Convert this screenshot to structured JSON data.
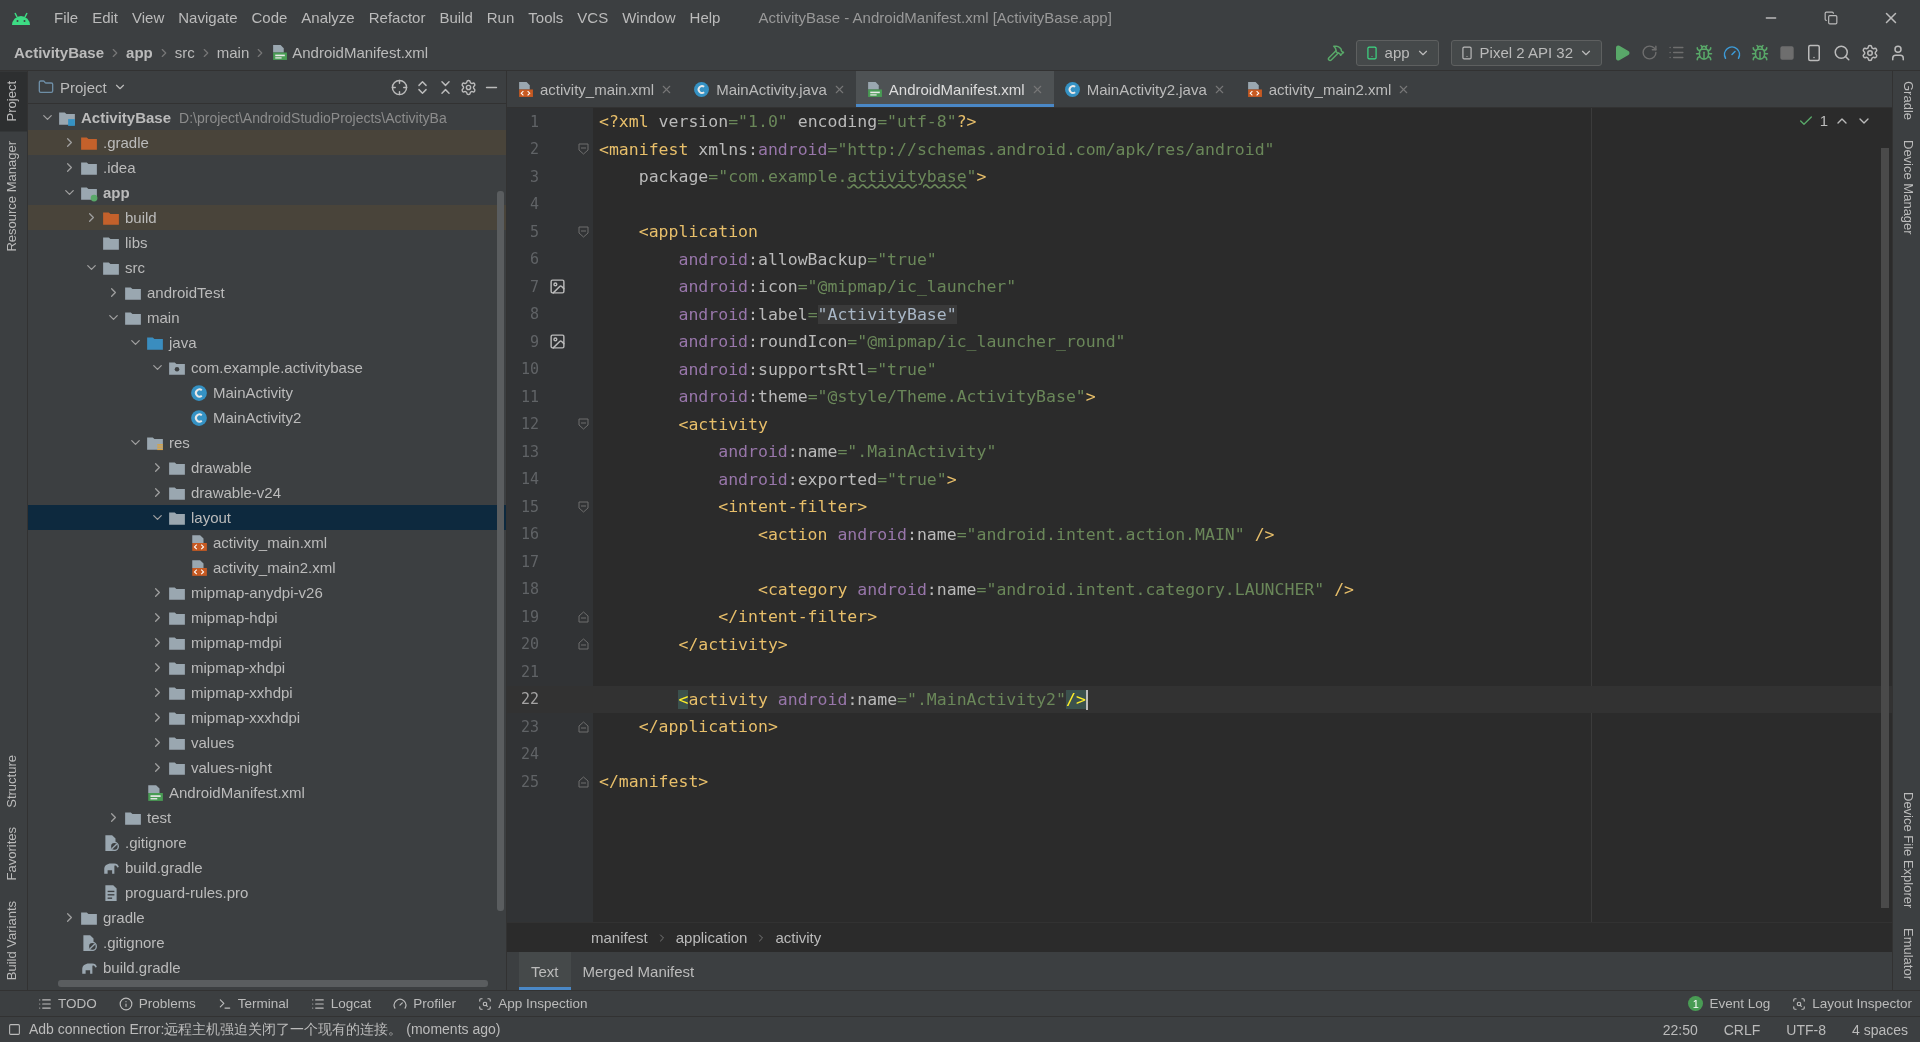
{
  "menu_bar": {
    "items": [
      "File",
      "Edit",
      "View",
      "Navigate",
      "Code",
      "Analyze",
      "Refactor",
      "Build",
      "Run",
      "Tools",
      "VCS",
      "Window",
      "Help"
    ],
    "title": "ActivityBase - AndroidManifest.xml [ActivityBase.app]"
  },
  "nav_bar": {
    "breadcrumbs": [
      {
        "label": "ActivityBase",
        "kind": "bold"
      },
      {
        "label": "app",
        "kind": "bold"
      },
      {
        "label": "src",
        "kind": "plain"
      },
      {
        "label": "main",
        "kind": "plain"
      },
      {
        "label": "AndroidManifest.xml",
        "kind": "manifest"
      }
    ],
    "run_config": "app",
    "device": "Pixel 2 API 32"
  },
  "left_tool_strip": {
    "top": [
      {
        "label": "Project",
        "selected": true
      },
      {
        "label": "Resource Manager",
        "selected": false
      }
    ],
    "bottom": [
      {
        "label": "Structure",
        "selected": false
      },
      {
        "label": "Favorites",
        "selected": false
      },
      {
        "label": "Build Variants",
        "selected": false
      }
    ]
  },
  "right_tool_strip": {
    "top": [
      {
        "label": "Gradle"
      },
      {
        "label": "Device Manager"
      }
    ],
    "bottom": [
      {
        "label": "Device File Explorer"
      },
      {
        "label": "Emulator"
      }
    ]
  },
  "project_panel": {
    "title": "Project",
    "tree": [
      {
        "label": "ActivityBase",
        "path": "D:\\project\\AndroidStudioProjects\\ActivityBa",
        "kind": "project",
        "expanded": true,
        "selected": false,
        "children": [
          {
            "label": ".gradle",
            "kind": "excluded-folder",
            "expanded": false,
            "selected": false
          },
          {
            "label": ".idea",
            "kind": "folder",
            "expanded": false,
            "selected": false
          },
          {
            "label": "app",
            "kind": "module",
            "expanded": true,
            "selected": false,
            "children": [
              {
                "label": "build",
                "kind": "excluded-folder",
                "expanded": false,
                "selected": false
              },
              {
                "label": "libs",
                "kind": "folder",
                "selected": false
              },
              {
                "label": "src",
                "kind": "folder",
                "expanded": true,
                "selected": false,
                "children": [
                  {
                    "label": "androidTest",
                    "kind": "folder",
                    "expanded": false,
                    "selected": false
                  },
                  {
                    "label": "main",
                    "kind": "folder",
                    "expanded": true,
                    "selected": false,
                    "children": [
                      {
                        "label": "java",
                        "kind": "source-folder",
                        "expanded": true,
                        "selected": false,
                        "children": [
                          {
                            "label": "com.example.activitybase",
                            "kind": "package",
                            "expanded": true,
                            "selected": false,
                            "children": [
                              {
                                "label": "MainActivity",
                                "kind": "class",
                                "selected": false
                              },
                              {
                                "label": "MainActivity2",
                                "kind": "class",
                                "selected": false
                              }
                            ]
                          }
                        ]
                      },
                      {
                        "label": "res",
                        "kind": "res-folder",
                        "expanded": true,
                        "selected": false,
                        "children": [
                          {
                            "label": "drawable",
                            "kind": "folder",
                            "expanded": false,
                            "selected": false
                          },
                          {
                            "label": "drawable-v24",
                            "kind": "folder",
                            "expanded": false,
                            "selected": false
                          },
                          {
                            "label": "layout",
                            "kind": "folder",
                            "expanded": true,
                            "selected": true,
                            "children": [
                              {
                                "label": "activity_main.xml",
                                "kind": "xml",
                                "selected": false
                              },
                              {
                                "label": "activity_main2.xml",
                                "kind": "xml",
                                "selected": false
                              }
                            ]
                          },
                          {
                            "label": "mipmap-anydpi-v26",
                            "kind": "folder",
                            "expanded": false,
                            "selected": false
                          },
                          {
                            "label": "mipmap-hdpi",
                            "kind": "folder",
                            "expanded": false,
                            "selected": false
                          },
                          {
                            "label": "mipmap-mdpi",
                            "kind": "folder",
                            "expanded": false,
                            "selected": false
                          },
                          {
                            "label": "mipmap-xhdpi",
                            "kind": "folder",
                            "expanded": false,
                            "selected": false
                          },
                          {
                            "label": "mipmap-xxhdpi",
                            "kind": "folder",
                            "expanded": false,
                            "selected": false
                          },
                          {
                            "label": "mipmap-xxxhdpi",
                            "kind": "folder",
                            "expanded": false,
                            "selected": false
                          },
                          {
                            "label": "values",
                            "kind": "folder",
                            "expanded": false,
                            "selected": false
                          },
                          {
                            "label": "values-night",
                            "kind": "folder",
                            "expanded": false,
                            "selected": false
                          }
                        ]
                      },
                      {
                        "label": "AndroidManifest.xml",
                        "kind": "manifest",
                        "selected": false
                      }
                    ]
                  },
                  {
                    "label": "test",
                    "kind": "folder",
                    "expanded": false,
                    "selected": false
                  }
                ]
              },
              {
                "label": ".gitignore",
                "kind": "ignore-file",
                "selected": false
              },
              {
                "label": "build.gradle",
                "kind": "gradle",
                "selected": false
              },
              {
                "label": "proguard-rules.pro",
                "kind": "text-file",
                "selected": false
              }
            ]
          },
          {
            "label": "gradle",
            "kind": "folder",
            "expanded": false,
            "selected": false
          },
          {
            "label": ".gitignore",
            "kind": "ignore-file",
            "selected": false
          },
          {
            "label": "build.gradle",
            "kind": "gradle",
            "selected": false
          }
        ]
      }
    ]
  },
  "editor_tabs": [
    {
      "label": "activity_main.xml",
      "kind": "xml",
      "selected": false
    },
    {
      "label": "MainActivity.java",
      "kind": "class",
      "selected": false
    },
    {
      "label": "AndroidManifest.xml",
      "kind": "manifest",
      "selected": true
    },
    {
      "label": "MainActivity2.java",
      "kind": "class",
      "selected": false
    },
    {
      "label": "activity_main2.xml",
      "kind": "xml",
      "selected": false
    }
  ],
  "editor": {
    "inspection_count": "1",
    "lines": [
      {
        "number": "1",
        "kind": "plain",
        "current": false,
        "tokens": [
          {
            "kind": "tag",
            "text": "<?xml"
          },
          {
            "kind": "plain",
            "text": " version"
          },
          {
            "kind": "str",
            "text": "=\"1.0\""
          },
          {
            "kind": "plain",
            "text": " encoding"
          },
          {
            "kind": "str",
            "text": "=\"utf-8\""
          },
          {
            "kind": "tag",
            "text": "?>"
          }
        ]
      },
      {
        "number": "2",
        "kind": "fold-start",
        "current": false,
        "tokens": [
          {
            "kind": "tag",
            "text": "<manifest"
          },
          {
            "kind": "plain",
            "text": " xmlns:"
          },
          {
            "kind": "ns",
            "text": "android"
          },
          {
            "kind": "str",
            "text": "=\"http://schemas.android.com/apk/res/android\""
          }
        ]
      },
      {
        "number": "3",
        "kind": "plain",
        "current": false,
        "tokens": [
          {
            "kind": "plain",
            "text": "    package"
          },
          {
            "kind": "str",
            "text": "=\"com.example."
          },
          {
            "kind": "typo",
            "text": "activitybase"
          },
          {
            "kind": "str",
            "text": "\""
          },
          {
            "kind": "tag",
            "text": ">"
          }
        ]
      },
      {
        "number": "4",
        "kind": "plain",
        "current": false
      },
      {
        "number": "5",
        "kind": "fold-start",
        "current": false,
        "tokens": [
          {
            "kind": "tag",
            "text": "    <application"
          }
        ]
      },
      {
        "number": "6",
        "kind": "plain",
        "current": false,
        "tokens": [
          {
            "kind": "ns",
            "text": "        android"
          },
          {
            "kind": "plain",
            "text": ":allowBackup"
          },
          {
            "kind": "str",
            "text": "=\"true\""
          }
        ]
      },
      {
        "number": "7",
        "kind": "image",
        "current": false,
        "tokens": [
          {
            "kind": "ns",
            "text": "        android"
          },
          {
            "kind": "plain",
            "text": ":icon"
          },
          {
            "kind": "str",
            "text": "=\"@mipmap/ic_launcher\""
          }
        ]
      },
      {
        "number": "8",
        "kind": "plain",
        "current": false,
        "tokens": [
          {
            "kind": "ns",
            "text": "        android"
          },
          {
            "kind": "plain",
            "text": ":label"
          },
          {
            "kind": "str",
            "text": "="
          },
          {
            "kind": "folded",
            "text": "\"ActivityBase\""
          }
        ]
      },
      {
        "number": "9",
        "kind": "image",
        "current": false,
        "tokens": [
          {
            "kind": "ns",
            "text": "        android"
          },
          {
            "kind": "plain",
            "text": ":roundIcon"
          },
          {
            "kind": "str",
            "text": "=\"@mipmap/ic_launcher_round\""
          }
        ]
      },
      {
        "number": "10",
        "kind": "plain",
        "current": false,
        "tokens": [
          {
            "kind": "ns",
            "text": "        android"
          },
          {
            "kind": "plain",
            "text": ":supportsRtl"
          },
          {
            "kind": "str",
            "text": "=\"true\""
          }
        ]
      },
      {
        "number": "11",
        "kind": "plain",
        "current": false,
        "tokens": [
          {
            "kind": "ns",
            "text": "        android"
          },
          {
            "kind": "plain",
            "text": ":theme"
          },
          {
            "kind": "str",
            "text": "=\"@style/Theme.ActivityBase\""
          },
          {
            "kind": "tag",
            "text": ">"
          }
        ]
      },
      {
        "number": "12",
        "kind": "fold-start",
        "current": false,
        "tokens": [
          {
            "kind": "tag",
            "text": "        <activity"
          }
        ]
      },
      {
        "number": "13",
        "kind": "plain",
        "current": false,
        "tokens": [
          {
            "kind": "ns",
            "text": "            android"
          },
          {
            "kind": "plain",
            "text": ":name"
          },
          {
            "kind": "str",
            "text": "=\".MainActivity\""
          }
        ]
      },
      {
        "number": "14",
        "kind": "plain",
        "current": false,
        "tokens": [
          {
            "kind": "ns",
            "text": "            android"
          },
          {
            "kind": "plain",
            "text": ":exported"
          },
          {
            "kind": "str",
            "text": "=\"true\""
          },
          {
            "kind": "tag",
            "text": ">"
          }
        ]
      },
      {
        "number": "15",
        "kind": "fold-start",
        "current": false,
        "tokens": [
          {
            "kind": "tag",
            "text": "            <intent-filter>"
          }
        ]
      },
      {
        "number": "16",
        "kind": "plain",
        "current": false,
        "tokens": [
          {
            "kind": "tag",
            "text": "                <action"
          },
          {
            "kind": "ns",
            "text": " android"
          },
          {
            "kind": "plain",
            "text": ":name"
          },
          {
            "kind": "str",
            "text": "=\"android.intent.action.MAIN\""
          },
          {
            "kind": "tag",
            "text": " />"
          }
        ]
      },
      {
        "number": "17",
        "kind": "plain",
        "current": false
      },
      {
        "number": "18",
        "kind": "plain",
        "current": false,
        "tokens": [
          {
            "kind": "tag",
            "text": "                <category"
          },
          {
            "kind": "ns",
            "text": " android"
          },
          {
            "kind": "plain",
            "text": ":name"
          },
          {
            "kind": "str",
            "text": "=\"android.intent.category.LAUNCHER\""
          },
          {
            "kind": "tag",
            "text": " />"
          }
        ]
      },
      {
        "number": "19",
        "kind": "fold-end",
        "current": false,
        "tokens": [
          {
            "kind": "tag",
            "text": "            </intent-filter>"
          }
        ]
      },
      {
        "number": "20",
        "kind": "fold-end",
        "current": false,
        "tokens": [
          {
            "kind": "tag",
            "text": "        </activity>"
          }
        ]
      },
      {
        "number": "21",
        "kind": "plain",
        "current": false
      },
      {
        "number": "22",
        "kind": "plain",
        "current": true,
        "tokens": [
          {
            "kind": "match",
            "text": "        <"
          },
          {
            "kind": "tag",
            "text": "activity"
          },
          {
            "kind": "ns",
            "text": " android"
          },
          {
            "kind": "plain",
            "text": ":name"
          },
          {
            "kind": "str",
            "text": "=\".MainActivity2\""
          },
          {
            "kind": "match",
            "text": "/>"
          }
        ]
      },
      {
        "number": "23",
        "kind": "fold-end",
        "current": false,
        "tokens": [
          {
            "kind": "tag",
            "text": "    </application>"
          }
        ]
      },
      {
        "number": "24",
        "kind": "plain",
        "current": false
      },
      {
        "number": "25",
        "kind": "fold-end",
        "current": false,
        "tokens": [
          {
            "kind": "tag",
            "text": "</manifest>"
          }
        ]
      }
    ]
  },
  "editor_breadcrumbs": [
    "manifest",
    "application",
    "activity"
  ],
  "editor_view_tabs": [
    {
      "label": "Text",
      "selected": true
    },
    {
      "label": "Merged Manifest",
      "selected": false
    }
  ],
  "tool_windows": [
    {
      "label": "TODO",
      "kind": "list"
    },
    {
      "label": "Problems",
      "kind": "info"
    },
    {
      "label": "Terminal",
      "kind": "terminal"
    },
    {
      "label": "Logcat",
      "kind": "list"
    },
    {
      "label": "Profiler",
      "kind": "gauge"
    },
    {
      "label": "App Inspection",
      "kind": "inspect"
    }
  ],
  "tool_windows_right": [
    {
      "label": "Event Log",
      "badge": "1"
    },
    {
      "label": "Layout Inspector"
    }
  ],
  "status_bar": {
    "message": "Adb connection Error:远程主机强迫关闭了一个现有的连接。 (moments ago)",
    "items": [
      "22:50",
      "CRLF",
      "UTF-8",
      "4 spaces"
    ]
  }
}
